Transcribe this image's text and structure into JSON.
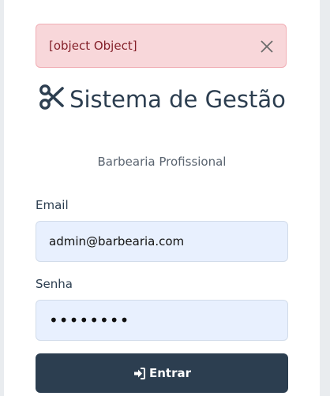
{
  "alert": {
    "message": "[object Object]",
    "close_icon": "close-icon"
  },
  "header": {
    "icon": "scissors-icon",
    "title": "Sistema de Gestão",
    "subtitle": "Barbearia Profissional"
  },
  "form": {
    "email_label": "Email",
    "email_value": "admin@barbearia.com",
    "password_label": "Senha",
    "password_value": "••••••••",
    "submit_label": "Entrar",
    "submit_icon": "sign-in-icon"
  },
  "colors": {
    "primary": "#2c3e50",
    "alert_bg": "#f8d7da",
    "alert_text": "#842029",
    "input_bg": "#e8f0fe"
  }
}
